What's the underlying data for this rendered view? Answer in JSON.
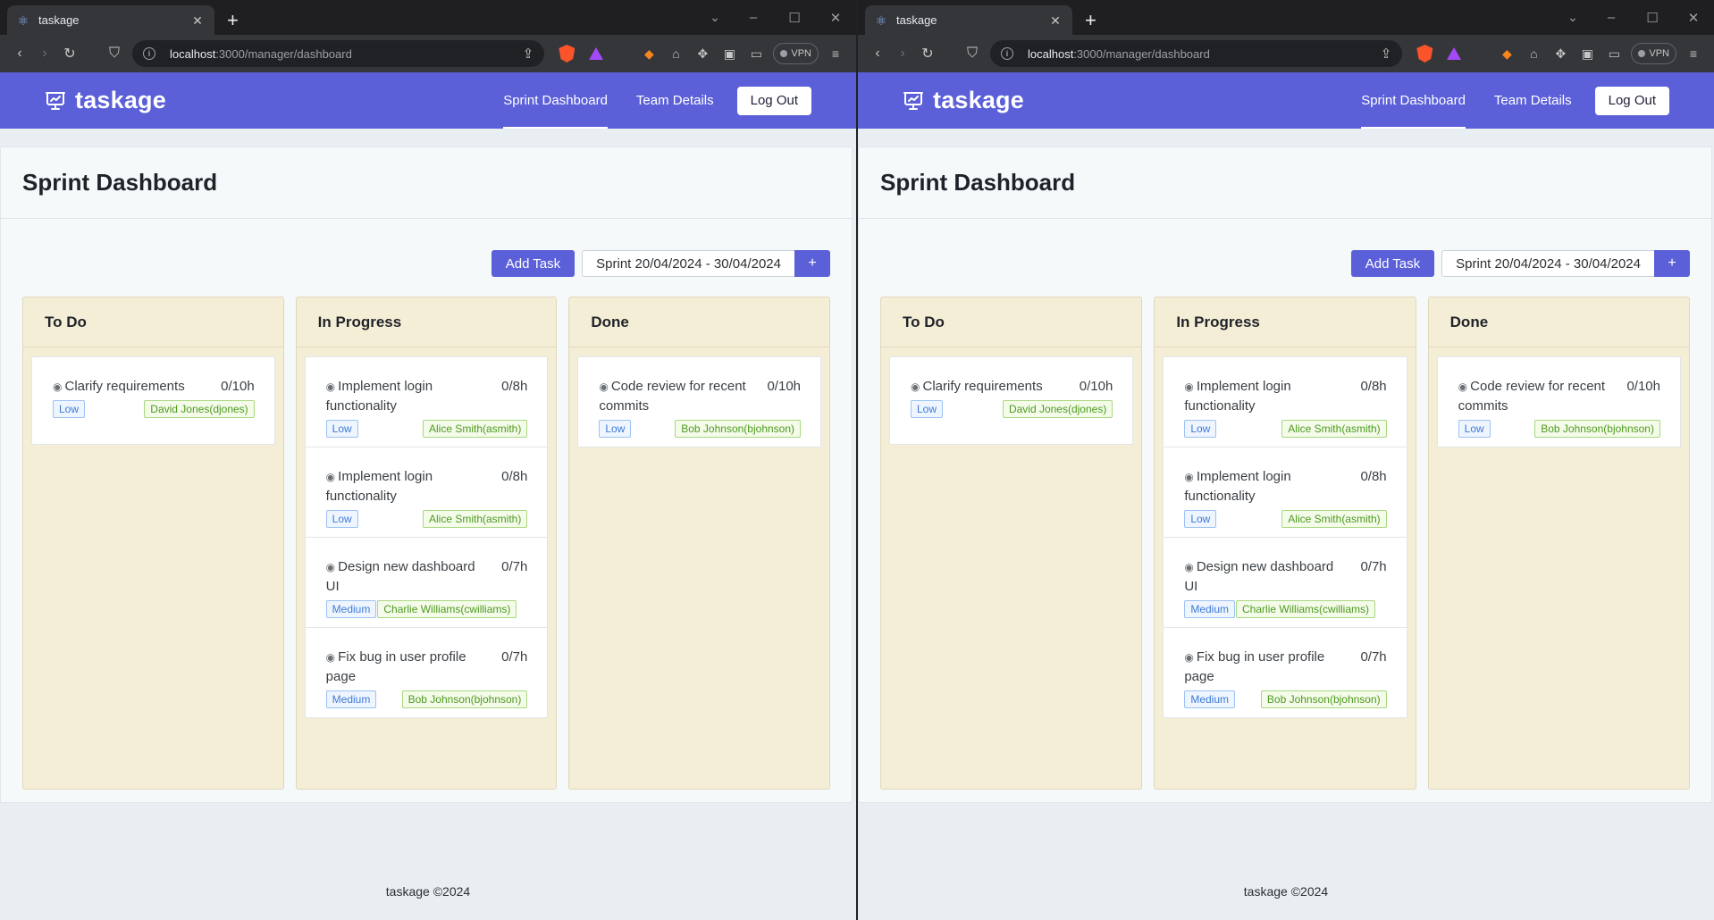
{
  "browser": {
    "tab_title": "taskage",
    "url_host": "localhost",
    "url_path": ":3000/manager/dashboard",
    "vpn_label": "VPN"
  },
  "nav": {
    "brand": "taskage",
    "links": [
      "Sprint Dashboard",
      "Team Details"
    ],
    "logout": "Log Out"
  },
  "page": {
    "title": "Sprint Dashboard",
    "add_task": "Add Task",
    "sprint": "Sprint 20/04/2024 - 30/04/2024",
    "plus": "+"
  },
  "columns": [
    {
      "name": "To Do",
      "tasks": [
        {
          "name": "Clarify requirements",
          "hours": "0/10h",
          "priority": "Low",
          "assignee": "David Jones(djones)"
        }
      ]
    },
    {
      "name": "In Progress",
      "tasks": [
        {
          "name": "Implement login functionality",
          "hours": "0/8h",
          "priority": "Low",
          "assignee": "Alice Smith(asmith)"
        },
        {
          "name": "Implement login functionality",
          "hours": "0/8h",
          "priority": "Low",
          "assignee": "Alice Smith(asmith)"
        },
        {
          "name": "Design new dashboard UI",
          "hours": "0/7h",
          "priority": "Medium",
          "assignee": "Charlie Williams(cwilliams)"
        },
        {
          "name": "Fix bug in user profile page",
          "hours": "0/7h",
          "priority": "Medium",
          "assignee": "Bob Johnson(bjohnson)"
        }
      ]
    },
    {
      "name": "Done",
      "tasks": [
        {
          "name": "Code review for recent commits",
          "hours": "0/10h",
          "priority": "Low",
          "assignee": "Bob Johnson(bjohnson)"
        }
      ]
    }
  ],
  "footer": "taskage ©2024",
  "colors": {
    "brand": "#5b5fd8",
    "column_bg": "#f5eed6",
    "priority_tag": "#3d7bd6",
    "assignee_tag": "#4d9a20"
  },
  "icons": {
    "brand_logo": "presentation-chart-icon",
    "task_eye": "eye-icon"
  }
}
